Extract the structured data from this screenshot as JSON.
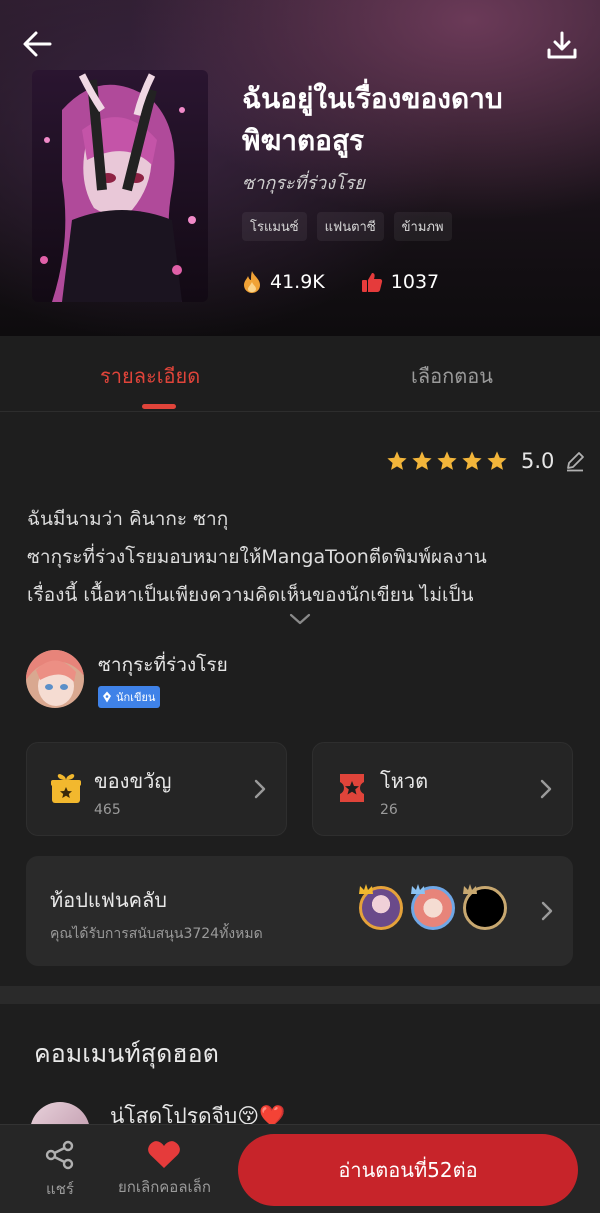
{
  "header": {
    "title_line1": "ฉันอยู่ในเรื่องของดาบ",
    "title_line2": "พิฆาตอสูร",
    "author": "ซากุระที่ร่วงโรย",
    "tags": [
      "โรแมนซ์",
      "แฟนตาซี",
      "ข้ามภพ"
    ],
    "views": "41.9K",
    "likes": "1037",
    "icons": {
      "back": "arrow-left-icon",
      "download": "download-icon",
      "views": "fire-icon",
      "likes": "thumbs-up-icon"
    }
  },
  "tabs": [
    {
      "label": "รายละเอียด",
      "active": true
    },
    {
      "label": "เลือกตอน",
      "active": false
    }
  ],
  "rating": {
    "value": "5.0",
    "stars": 5
  },
  "description": {
    "lines": [
      "ฉันมีนามว่า  คินากะ   ซากุ",
      "ซากุระที่ร่วงโรยมอบหมายให้MangaToonตีดพิมพ์ผลงาน",
      "เรื่องนี้ เนื้อหาเป็นเพียงความคิดเห็นของนักเขียน ไม่เป็น"
    ]
  },
  "author_block": {
    "name": "ซากุระที่ร่วงโรย",
    "badge": "นักเขียน"
  },
  "gift": {
    "label": "ของขวัญ",
    "count": "465"
  },
  "vote": {
    "label": "โหวต",
    "count": "26"
  },
  "fan_club": {
    "title": "ท้อปแฟนคลับ",
    "subtitle": "คุณได้รับการสนับสนุน3724ทั้งหมด"
  },
  "comments": {
    "title": "คอมเมนท์สุดฮอต",
    "first": "น่โสดโปรดจีบ😚❤️"
  },
  "bottom_bar": {
    "share_label": "แชร์",
    "unfav_label": "ยกเลิกคอลเล็ก",
    "read_label": "อ่านตอนที่52ต่อ"
  },
  "colors": {
    "accent": "#e0443a",
    "read_button": "#c7242a",
    "star": "#f2b53a",
    "badge": "#3f82e8"
  }
}
